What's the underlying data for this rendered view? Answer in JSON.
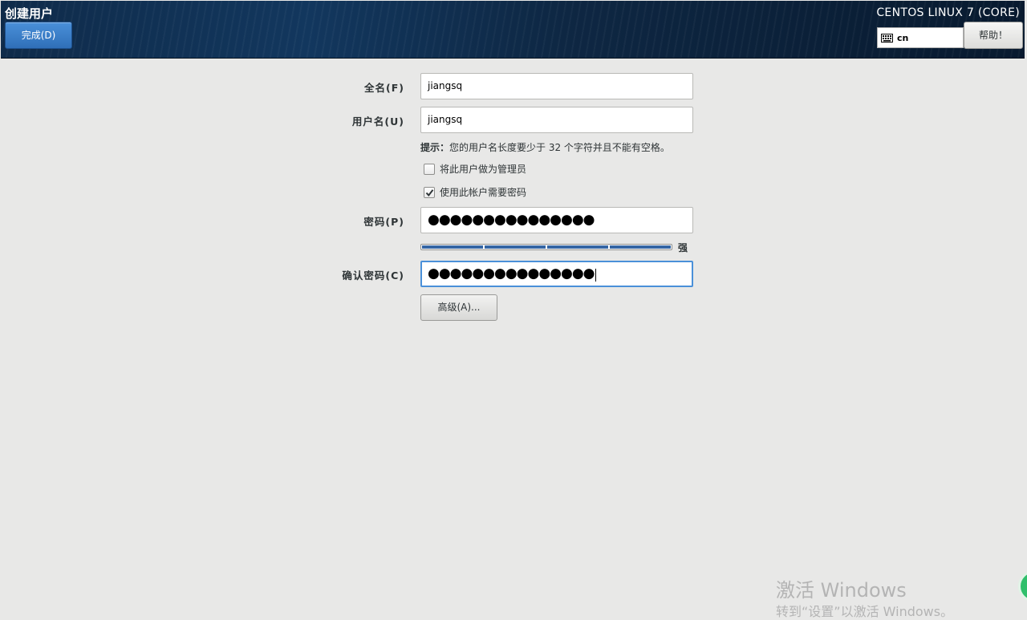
{
  "header": {
    "title": "创建用户",
    "done_label": "完成(D)",
    "os_name": "CENTOS LINUX 7 (CORE)",
    "keyboard_layout": "cn",
    "help_label": "帮助！",
    "accent_color": "#2f6fb8"
  },
  "form": {
    "fullname_label": "全名(F)",
    "fullname_value": "jiangsq",
    "username_label": "用户名(U)",
    "username_value": "jiangsq",
    "hint_prefix": "提示：",
    "hint_text": "您的用户名长度要少于 32 个字符并且不能有空格。",
    "admin_checkbox_label": "将此用户做为管理员",
    "admin_checked": false,
    "require_password_label": "使用此帐户需要密码",
    "require_password_checked": true,
    "password_label": "密码(P)",
    "password_masked": "●●●●●●●●●●●●●●●",
    "strength_label": "强",
    "strength_level": 1.0,
    "confirm_label": "确认密码(C)",
    "confirm_masked": "●●●●●●●●●●●●●●●",
    "advanced_label": "高级(A)..."
  },
  "watermark": {
    "line1": "激活 Windows",
    "line2": "转到“设置”以激活 Windows。"
  }
}
